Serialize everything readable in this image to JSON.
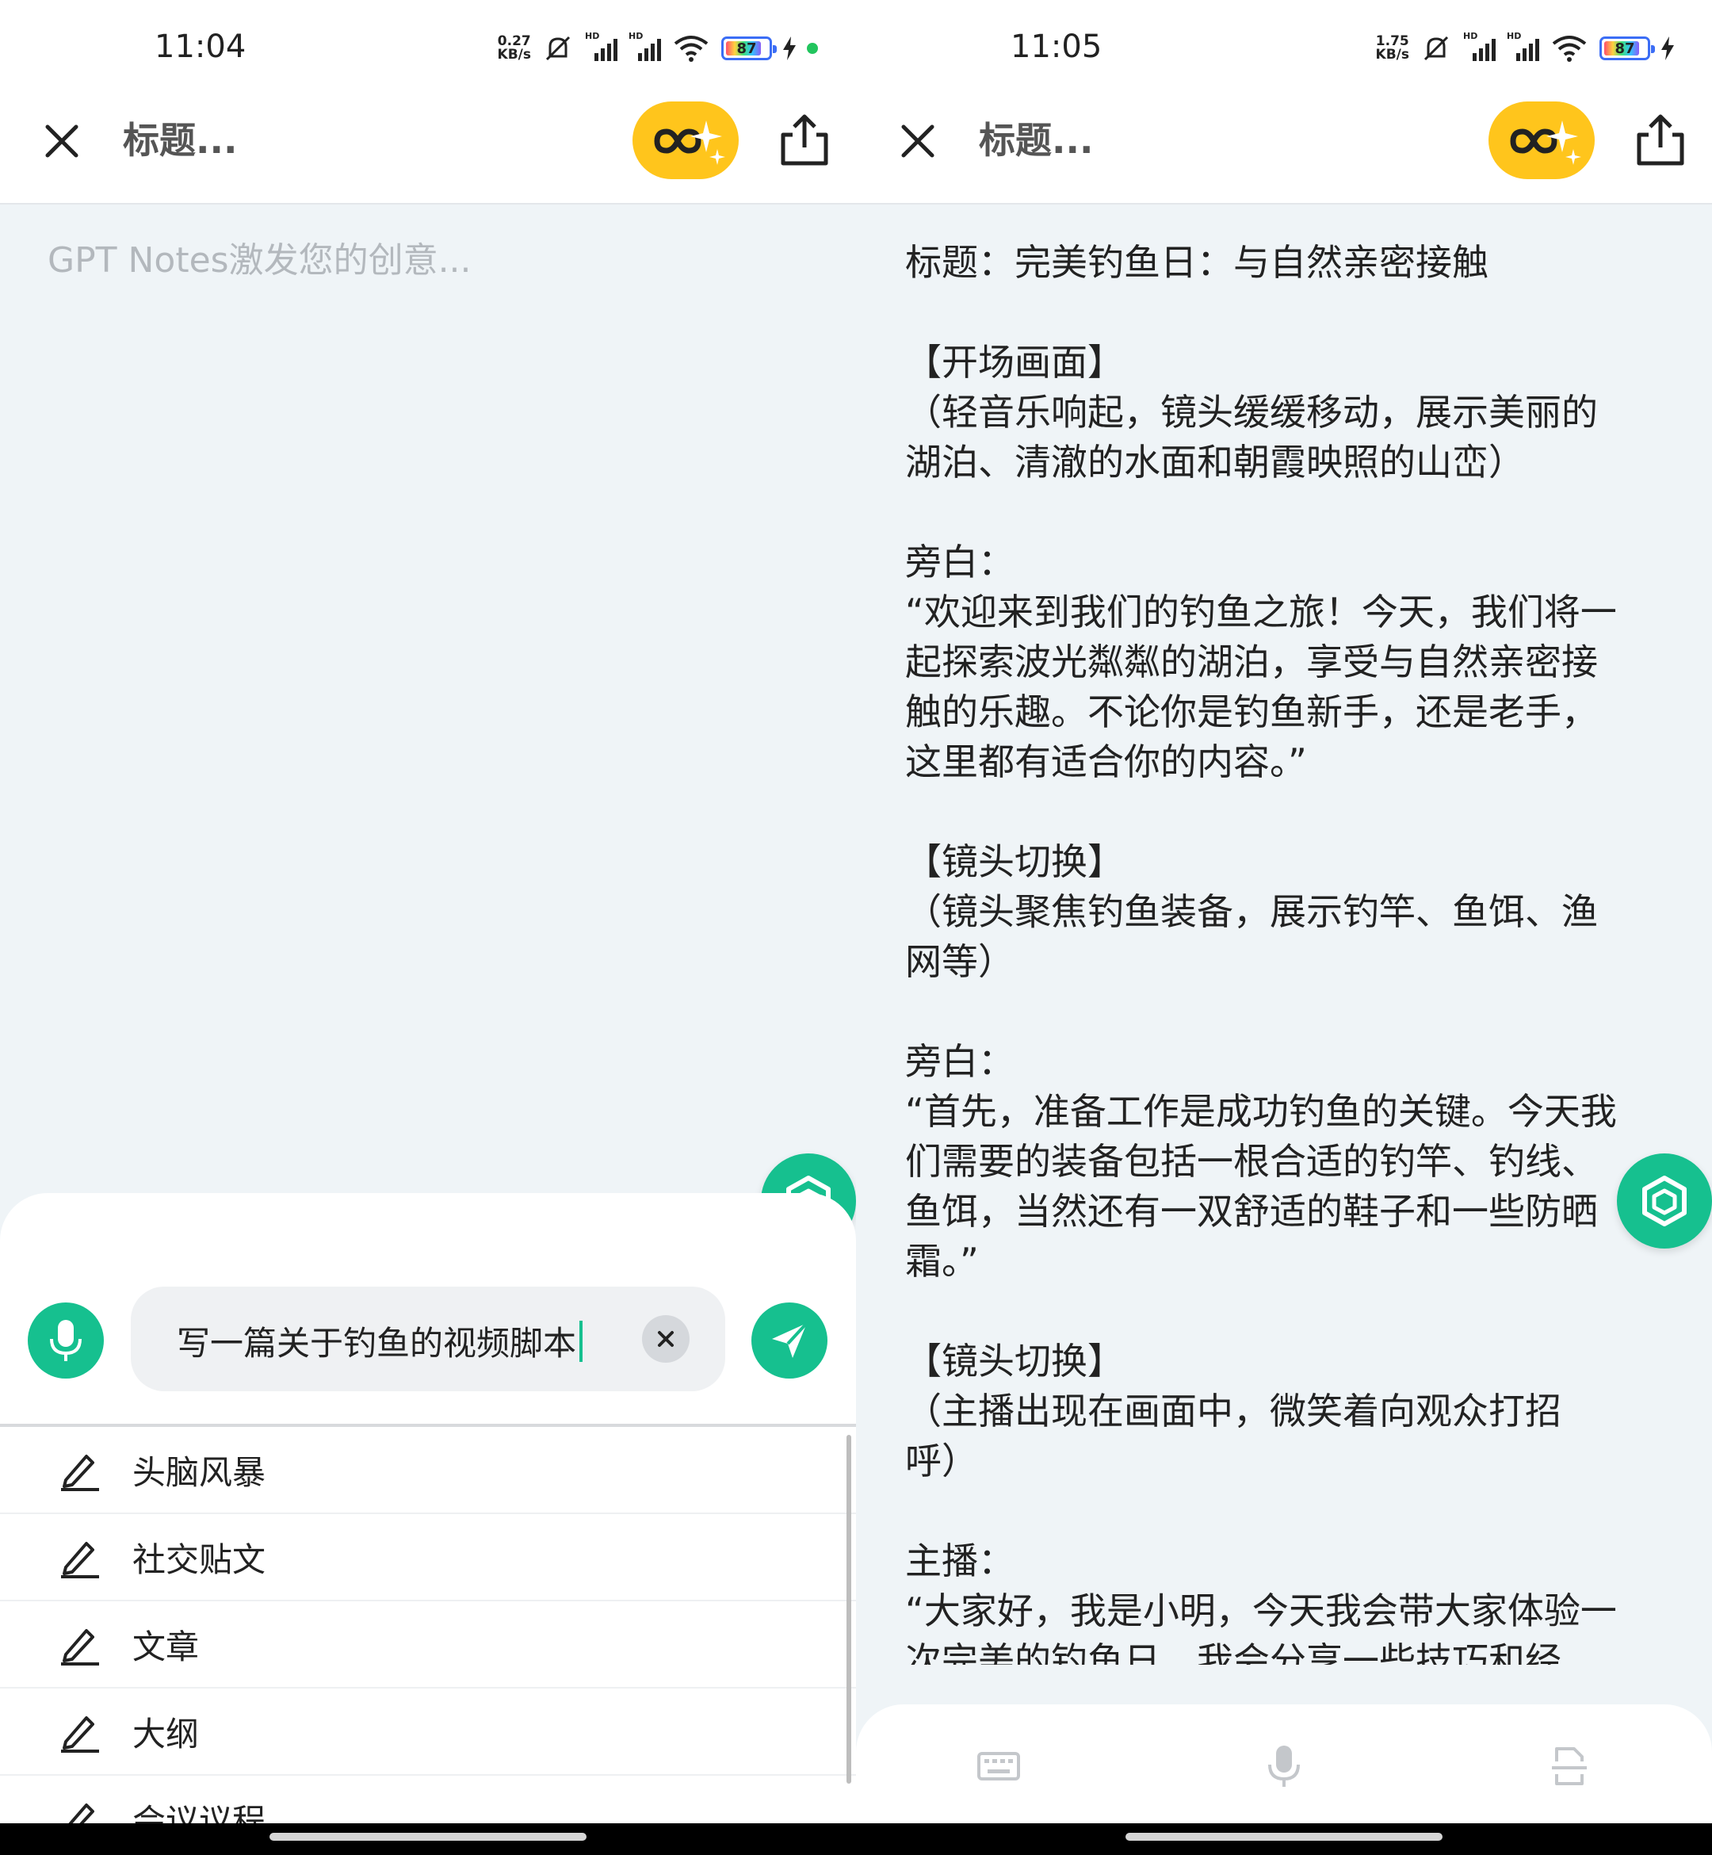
{
  "left": {
    "status": {
      "time": "11:04",
      "net_speed": "0.27",
      "net_unit": "KB/s",
      "battery": "87"
    },
    "header": {
      "title_placeholder": "标题..."
    },
    "editor": {
      "placeholder": "GPT Notes激发您的创意..."
    },
    "prompt": {
      "text": "写一篇关于钓鱼的视频脚本"
    },
    "suggestions": [
      "头脑风暴",
      "社交贴文",
      "文章",
      "大纲",
      "会议议程"
    ]
  },
  "right": {
    "status": {
      "time": "11:05",
      "net_speed": "1.75",
      "net_unit": "KB/s",
      "battery": "87"
    },
    "header": {
      "title_placeholder": "标题..."
    },
    "document_lines": [
      "标题：完美钓鱼日：与自然亲密接触",
      "",
      "【开场画面】",
      "（轻音乐响起，镜头缓缓移动，展示美丽的",
      "湖泊、清澈的水面和朝霞映照的山峦）",
      "",
      "旁白：",
      "“欢迎来到我们的钓鱼之旅！今天，我们将一",
      "起探索波光粼粼的湖泊，享受与自然亲密接",
      "触的乐趣。不论你是钓鱼新手，还是老手，",
      "这里都有适合你的内容。”",
      "",
      "【镜头切换】",
      "（镜头聚焦钓鱼装备，展示钓竿、鱼饵、渔",
      "网等）",
      "",
      "旁白：",
      "“首先，准备工作是成功钓鱼的关键。今天我",
      "们需要的装备包括一根合适的钓竿、钓线、",
      "鱼饵，当然还有一双舒适的鞋子和一些防晒",
      "霜。”",
      "",
      "【镜头切换】",
      "（主播出现在画面中，微笑着向观众打招",
      "呼）",
      "",
      "主播：",
      "“大家好，我是小明，今天我会带大家体验一",
      "次完美的钓鱼日，我会分享一些技巧和经"
    ]
  },
  "colors": {
    "accent": "#16c08f",
    "badge": "#ffc51c",
    "background": "#eff4f7"
  }
}
